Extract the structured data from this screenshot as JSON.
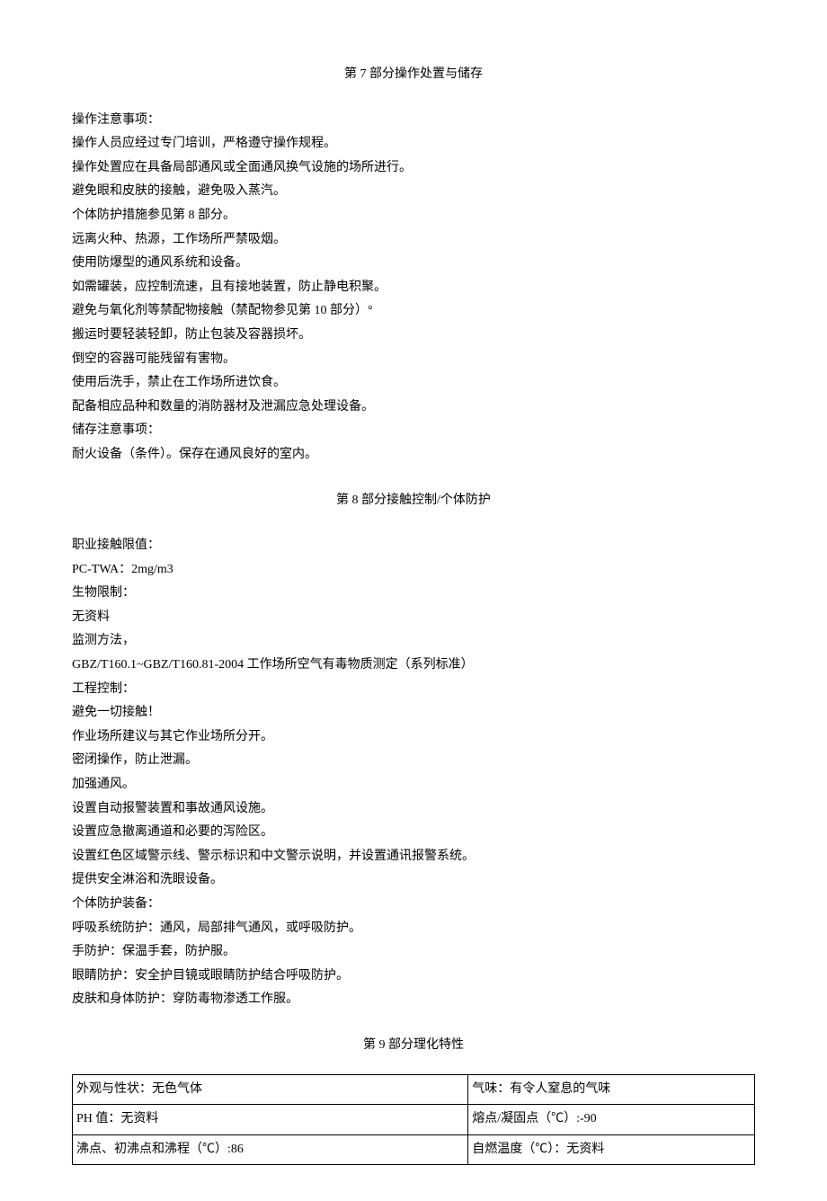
{
  "section7": {
    "title": "第 7 部分操作处置与储存",
    "lines": [
      "操作注意事项：",
      "操作人员应经过专门培训，严格遵守操作规程。",
      "操作处置应在具备局部通风或全面通风换气设施的场所进行。",
      "避免眼和皮肤的接触，避免吸入蒸汽。",
      "个体防护措施参见第 8 部分。",
      "远离火种、热源，工作场所严禁吸烟。",
      "使用防爆型的通风系统和设备。",
      "如需罐装，应控制流速，且有接地装置，防止静电积聚。",
      "避免与氧化剂等禁配物接触（禁配物参见第 10 部分）°",
      "搬运时要轻装轻卸，防止包装及容器损坏。",
      "倒空的容器可能残留有害物。",
      "使用后洗手，禁止在工作场所进饮食。",
      "配备相应品种和数量的消防器材及泄漏应急处理设备。",
      "储存注意事项：",
      "耐火设备（条件）。保存在通风良好的室内。"
    ]
  },
  "section8": {
    "title": "第 8 部分接触控制/个体防护",
    "lines": [
      "职业接触限值：",
      "PC-TWA：2mg/m3",
      "生物限制：",
      "无资料",
      "监测方法，",
      "GBZ/T160.1~GBZ/T160.81-2004 工作场所空气有毒物质测定（系列标准）",
      "工程控制：",
      "避免一切接触！",
      "作业场所建议与其它作业场所分开。",
      "密闭操作，防止泄漏。",
      "加强通风。",
      "设置自动报警装置和事故通风设施。",
      "设置应急撤离通道和必要的泻险区。",
      "设置红色区域警示线、警示标识和中文警示说明，并设置通讯报警系统。",
      "提供安全淋浴和洗眼设备。",
      "个体防护装备：",
      "呼吸系统防护：通风，局部排气通风，或呼吸防护。",
      "手防护：保温手套，防护服。",
      "眼睛防护：安全护目镜或眼睛防护结合呼吸防护。",
      "皮肤和身体防护：穿防毒物渗透工作服。"
    ]
  },
  "section9": {
    "title": "第 9 部分理化特性",
    "rows": [
      {
        "left": "外观与性状：无色气体",
        "right": "气味：有令人窒息的气味"
      },
      {
        "left": "PH 值：无资料",
        "right": "熔点/凝固点（℃）:-90"
      },
      {
        "left": "沸点、初沸点和沸程（℃）:86",
        "right": "自燃温度（℃）：无资料"
      }
    ]
  }
}
